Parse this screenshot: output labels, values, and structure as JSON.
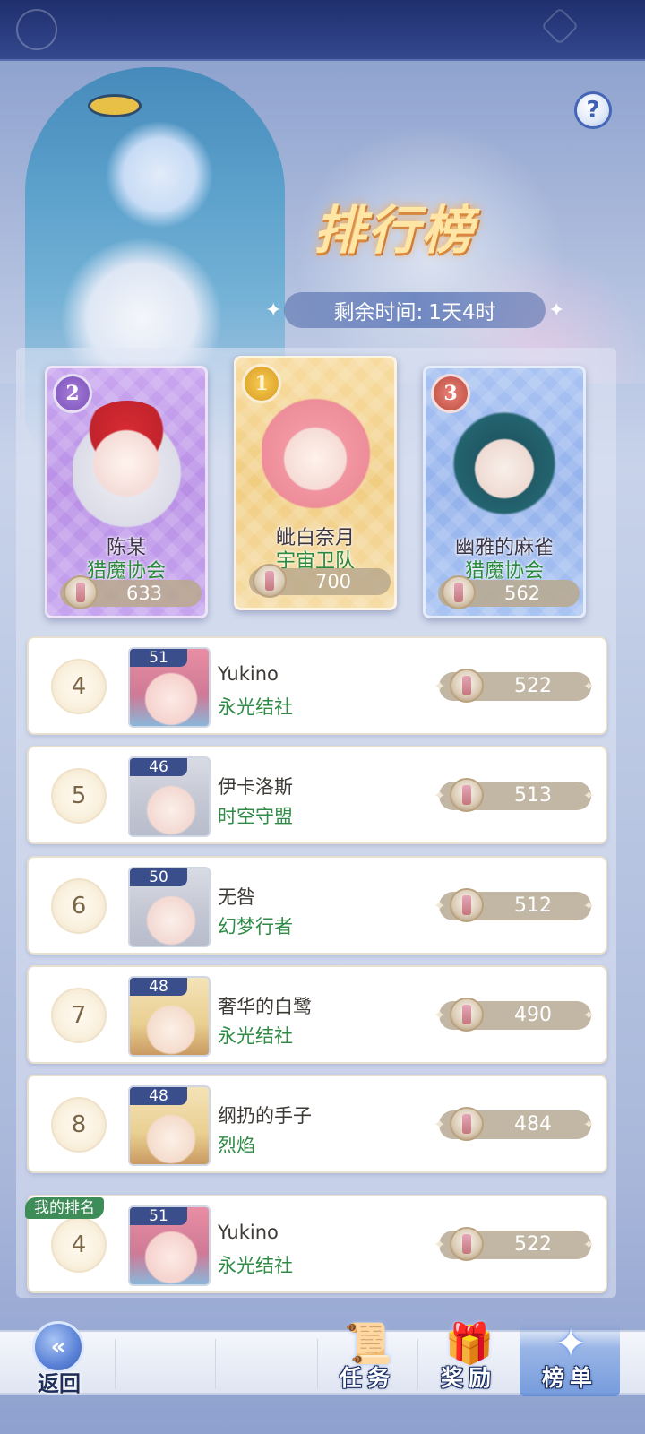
{
  "header": {
    "title": "排行榜",
    "timer_label": "剩余时间:",
    "timer_value": "1天4时",
    "help": "?"
  },
  "podium": [
    {
      "rank": "1",
      "name": "皉白奈月",
      "guild": "宇宙卫队",
      "score": "700"
    },
    {
      "rank": "2",
      "name": "陈某",
      "guild": "猎魔协会",
      "score": "633"
    },
    {
      "rank": "3",
      "name": "幽雅的麻雀",
      "guild": "猎魔协会",
      "score": "562"
    }
  ],
  "rows": [
    {
      "rank": "4",
      "level": "51",
      "name": "Yukino",
      "guild": "永光结社",
      "score": "522"
    },
    {
      "rank": "5",
      "level": "46",
      "name": "伊卡洛斯",
      "guild": "时空守盟",
      "score": "513"
    },
    {
      "rank": "6",
      "level": "50",
      "name": "无咎",
      "guild": "幻梦行者",
      "score": "512"
    },
    {
      "rank": "7",
      "level": "48",
      "name": "奢华的白鹭",
      "guild": "永光结社",
      "score": "490"
    },
    {
      "rank": "8",
      "level": "48",
      "name": "纲扔的手子",
      "guild": "烈焰",
      "score": "484"
    }
  ],
  "my_rank": {
    "tag": "我的排名",
    "rank": "4",
    "level": "51",
    "name": "Yukino",
    "guild": "永光结社",
    "score": "522"
  },
  "nav": {
    "back": "返回",
    "tasks": "任务",
    "rewards": "奖励",
    "leaderboard": "榜单"
  },
  "icons": {
    "help": "question-icon",
    "back": "back-arrow-icon",
    "tasks": "scroll-icon",
    "rewards": "gift-icon",
    "leaderboard": "star-icon",
    "score": "trophy-badge-icon"
  },
  "colors": {
    "guild_text": "#2f8b45",
    "rank1": "#f1cd82",
    "rank2": "#b98fe6",
    "rank3": "#93b1ec",
    "level_tag": "#3b4e8c"
  }
}
